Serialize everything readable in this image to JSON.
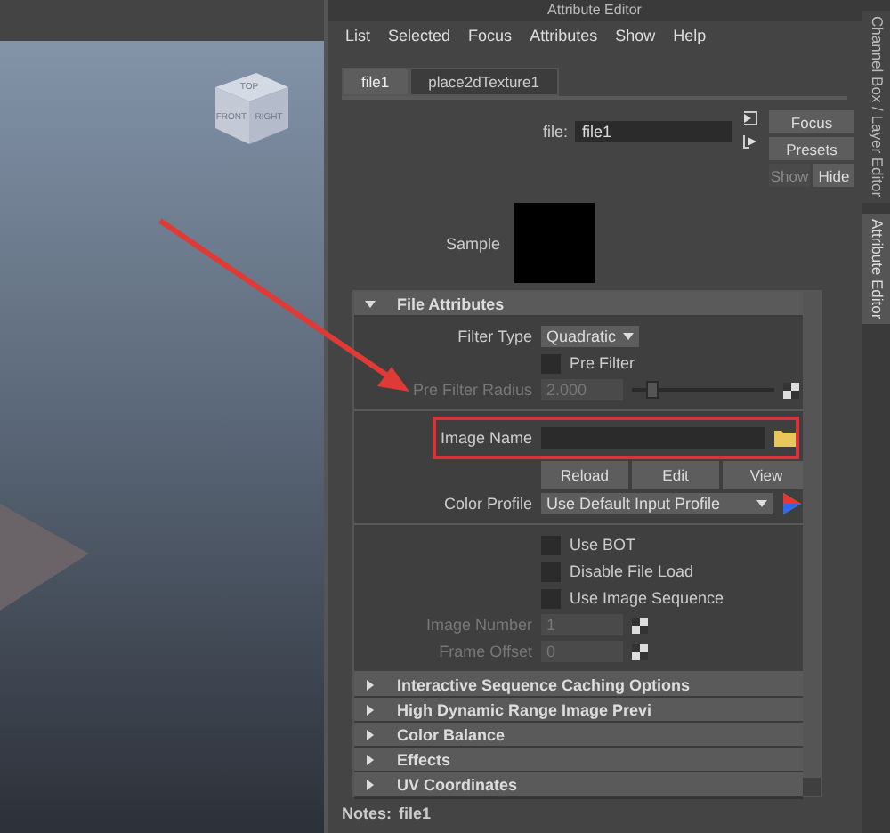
{
  "viewport": {
    "viewcube": [
      "TOP",
      "FRONT",
      "RIGHT"
    ]
  },
  "window": {
    "title": "Attribute Editor"
  },
  "menu": [
    "List",
    "Selected",
    "Focus",
    "Attributes",
    "Show",
    "Help"
  ],
  "tabs": [
    {
      "label": "file1",
      "selected": true
    },
    {
      "label": "place2dTexture1",
      "selected": false
    }
  ],
  "node": {
    "label": "file:",
    "value": "file1"
  },
  "side_buttons": [
    {
      "label": "Focus",
      "disabled": false
    },
    {
      "label": "Presets",
      "disabled": false
    },
    {
      "label": "Show",
      "disabled": true
    },
    {
      "label": "Hide",
      "disabled": false
    }
  ],
  "sample": {
    "label": "Sample"
  },
  "file_attributes": {
    "title": "File Attributes",
    "expanded": true,
    "groups": [
      [
        {
          "kind": "dropdown",
          "label": "Filter Type",
          "value": "Quadratic"
        },
        {
          "kind": "checkbox",
          "label": "Pre Filter",
          "checked": false
        },
        {
          "kind": "slider",
          "label": "Pre Filter Radius",
          "value": "2.000",
          "level": 0.1,
          "disabled": true
        }
      ],
      [
        {
          "kind": "file",
          "label": "Image Name",
          "highlighted": true
        },
        {
          "kind": "buttons",
          "buttons": [
            "Reload",
            "Edit",
            "View"
          ]
        },
        {
          "kind": "profile",
          "label": "Color Profile",
          "value": "Use Default Input Profile"
        }
      ],
      [
        {
          "kind": "checkbox",
          "label": "Use BOT",
          "checked": false
        },
        {
          "kind": "checkbox",
          "label": "Disable File Load",
          "checked": false
        },
        {
          "kind": "checkbox",
          "label": "Use Image Sequence",
          "checked": false
        },
        {
          "kind": "number",
          "label": "Image Number",
          "value": "1",
          "disabled": true
        },
        {
          "kind": "number",
          "label": "Frame Offset",
          "value": "0",
          "disabled": true
        }
      ]
    ]
  },
  "collapsed_sections": [
    {
      "title": "Interactive Sequence Caching Options",
      "expanded": false
    },
    {
      "title": "High Dynamic Range Image Previ",
      "expanded": false
    },
    {
      "title": "Color Balance",
      "expanded": false
    },
    {
      "title": "Effects",
      "expanded": false
    },
    {
      "title": "UV Coordinates",
      "expanded": false
    }
  ],
  "notes": {
    "label": "Notes:",
    "value": "file1"
  },
  "side_tabs": [
    {
      "label": "Channel Box / Layer Editor",
      "selected": false
    },
    {
      "label": "Attribute Editor",
      "selected": true
    }
  ]
}
